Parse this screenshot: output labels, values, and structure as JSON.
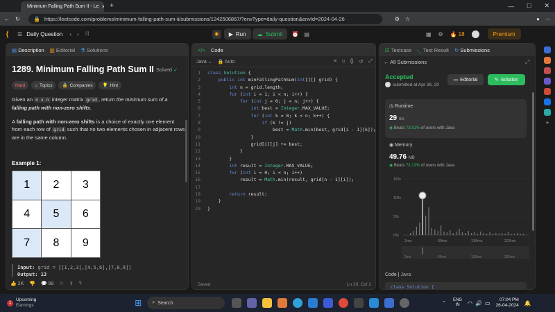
{
  "browser": {
    "tab_title": "Minimum Falling Path Sum II - Le",
    "url": "https://leetcode.com/problems/minimum-falling-path-sum-ii/submissions/1242506867/?envType=daily-question&envId=2024-04-26"
  },
  "nav": {
    "daily": "Daily Question",
    "run": "Run",
    "submit": "Submit",
    "streak": "18",
    "premium": "Premium"
  },
  "left": {
    "tabs": [
      "Description",
      "Editorial",
      "Solutions"
    ],
    "title": "1289. Minimum Falling Path Sum II",
    "status": "Solved",
    "chips": [
      "Hard",
      "Topics",
      "Companies",
      "Hint"
    ],
    "p1a": "Given an ",
    "p1b": "n x n",
    "p1c": " integer matrix ",
    "p1d": "grid",
    "p1e": ", return ",
    "p1f": "the minimum sum of a ",
    "p1g": "falling path with non-zero shifts",
    "p2a": "A ",
    "p2b": "falling path with non-zero shifts",
    "p2c": " is a choice of exactly one element from each row of ",
    "p2d": "grid",
    "p2e": " such that no two elements chosen in adjacent rows are in the same column.",
    "example": "Example 1:",
    "cells": [
      "1",
      "2",
      "3",
      "4",
      "5",
      "6",
      "7",
      "8",
      "9"
    ],
    "input_label": "Input:",
    "input_val": "grid = [[1,2,3],[4,5,6],[7,8,9]]",
    "output": "Output: 13",
    "likes": "2K",
    "comments": "99"
  },
  "code": {
    "header": "Code",
    "lang": "Java",
    "auto": "Auto",
    "status": "Saved",
    "pos": "Ln 20, Col 2",
    "lines": [
      "class Solution {",
      "    public int minFallingPathSum(int[][] grid) {",
      "        int n = grid.length;",
      "        for (int i = 1; i < n; i++) {",
      "            for (int j = 0; j < n; j++) {",
      "                int best = Integer.MAX_VALUE;",
      "                for (int k = 0; k < n; k++) {",
      "                    if (k != j)",
      "                        best = Math.min(best, grid[i - 1][k]);",
      "                }",
      "                grid[i][j] += best;",
      "            }",
      "        }",
      "        int result = Integer.MAX_VALUE;",
      "        for (int i = 0; i < n; i++)",
      "            result = Math.min(result, grid[n - 1][i]);",
      "",
      "        return result;",
      "    }",
      "}"
    ],
    "nums": [
      "1",
      "2",
      "3",
      "4",
      "5",
      "6",
      "7",
      "8",
      "9",
      "10",
      "11",
      "12",
      "13",
      "14",
      "15",
      "16",
      "17",
      "18",
      "19",
      "20"
    ]
  },
  "right": {
    "tabs": [
      "Testcase",
      "Test Result",
      "Submissions"
    ],
    "back": "All Submissions",
    "accepted": "Accepted",
    "submitted": "submitted at Apr 26, 20",
    "editorial": "Editorial",
    "solution": "Solution",
    "runtime_label": "Runtime",
    "runtime_val": "29",
    "runtime_unit": "ms",
    "runtime_beats_a": "Beats",
    "runtime_beats_b": "73.81%",
    "runtime_beats_c": "of users with Java",
    "memory_label": "Memory",
    "memory_val": "49.76",
    "memory_unit": "MB",
    "memory_beats_a": "Beats",
    "memory_beats_b": "73.13%",
    "memory_beats_c": "of users with Java",
    "y_ticks": [
      "15%",
      "10%",
      "5%",
      "0%"
    ],
    "x_ticks": [
      "2ms",
      "69ms",
      "136ms",
      "202ms"
    ],
    "mini_ticks": [
      "2ms",
      "69ms",
      "136ms",
      "202ms"
    ],
    "code_label": "Code",
    "code_lang": "Java",
    "code_peek": "class Solution {"
  },
  "taskbar": {
    "weather_title": "Upcoming",
    "weather_sub": "Earnings",
    "search": "Search",
    "lang1": "ENG",
    "lang2": "IN",
    "time": "07:04 PM",
    "date": "26-04-2024",
    "badge": "1"
  },
  "colors": {
    "accent_orange": "#ffa116",
    "green": "#2cbb5d",
    "blue_hl": "#dbe8f8"
  }
}
